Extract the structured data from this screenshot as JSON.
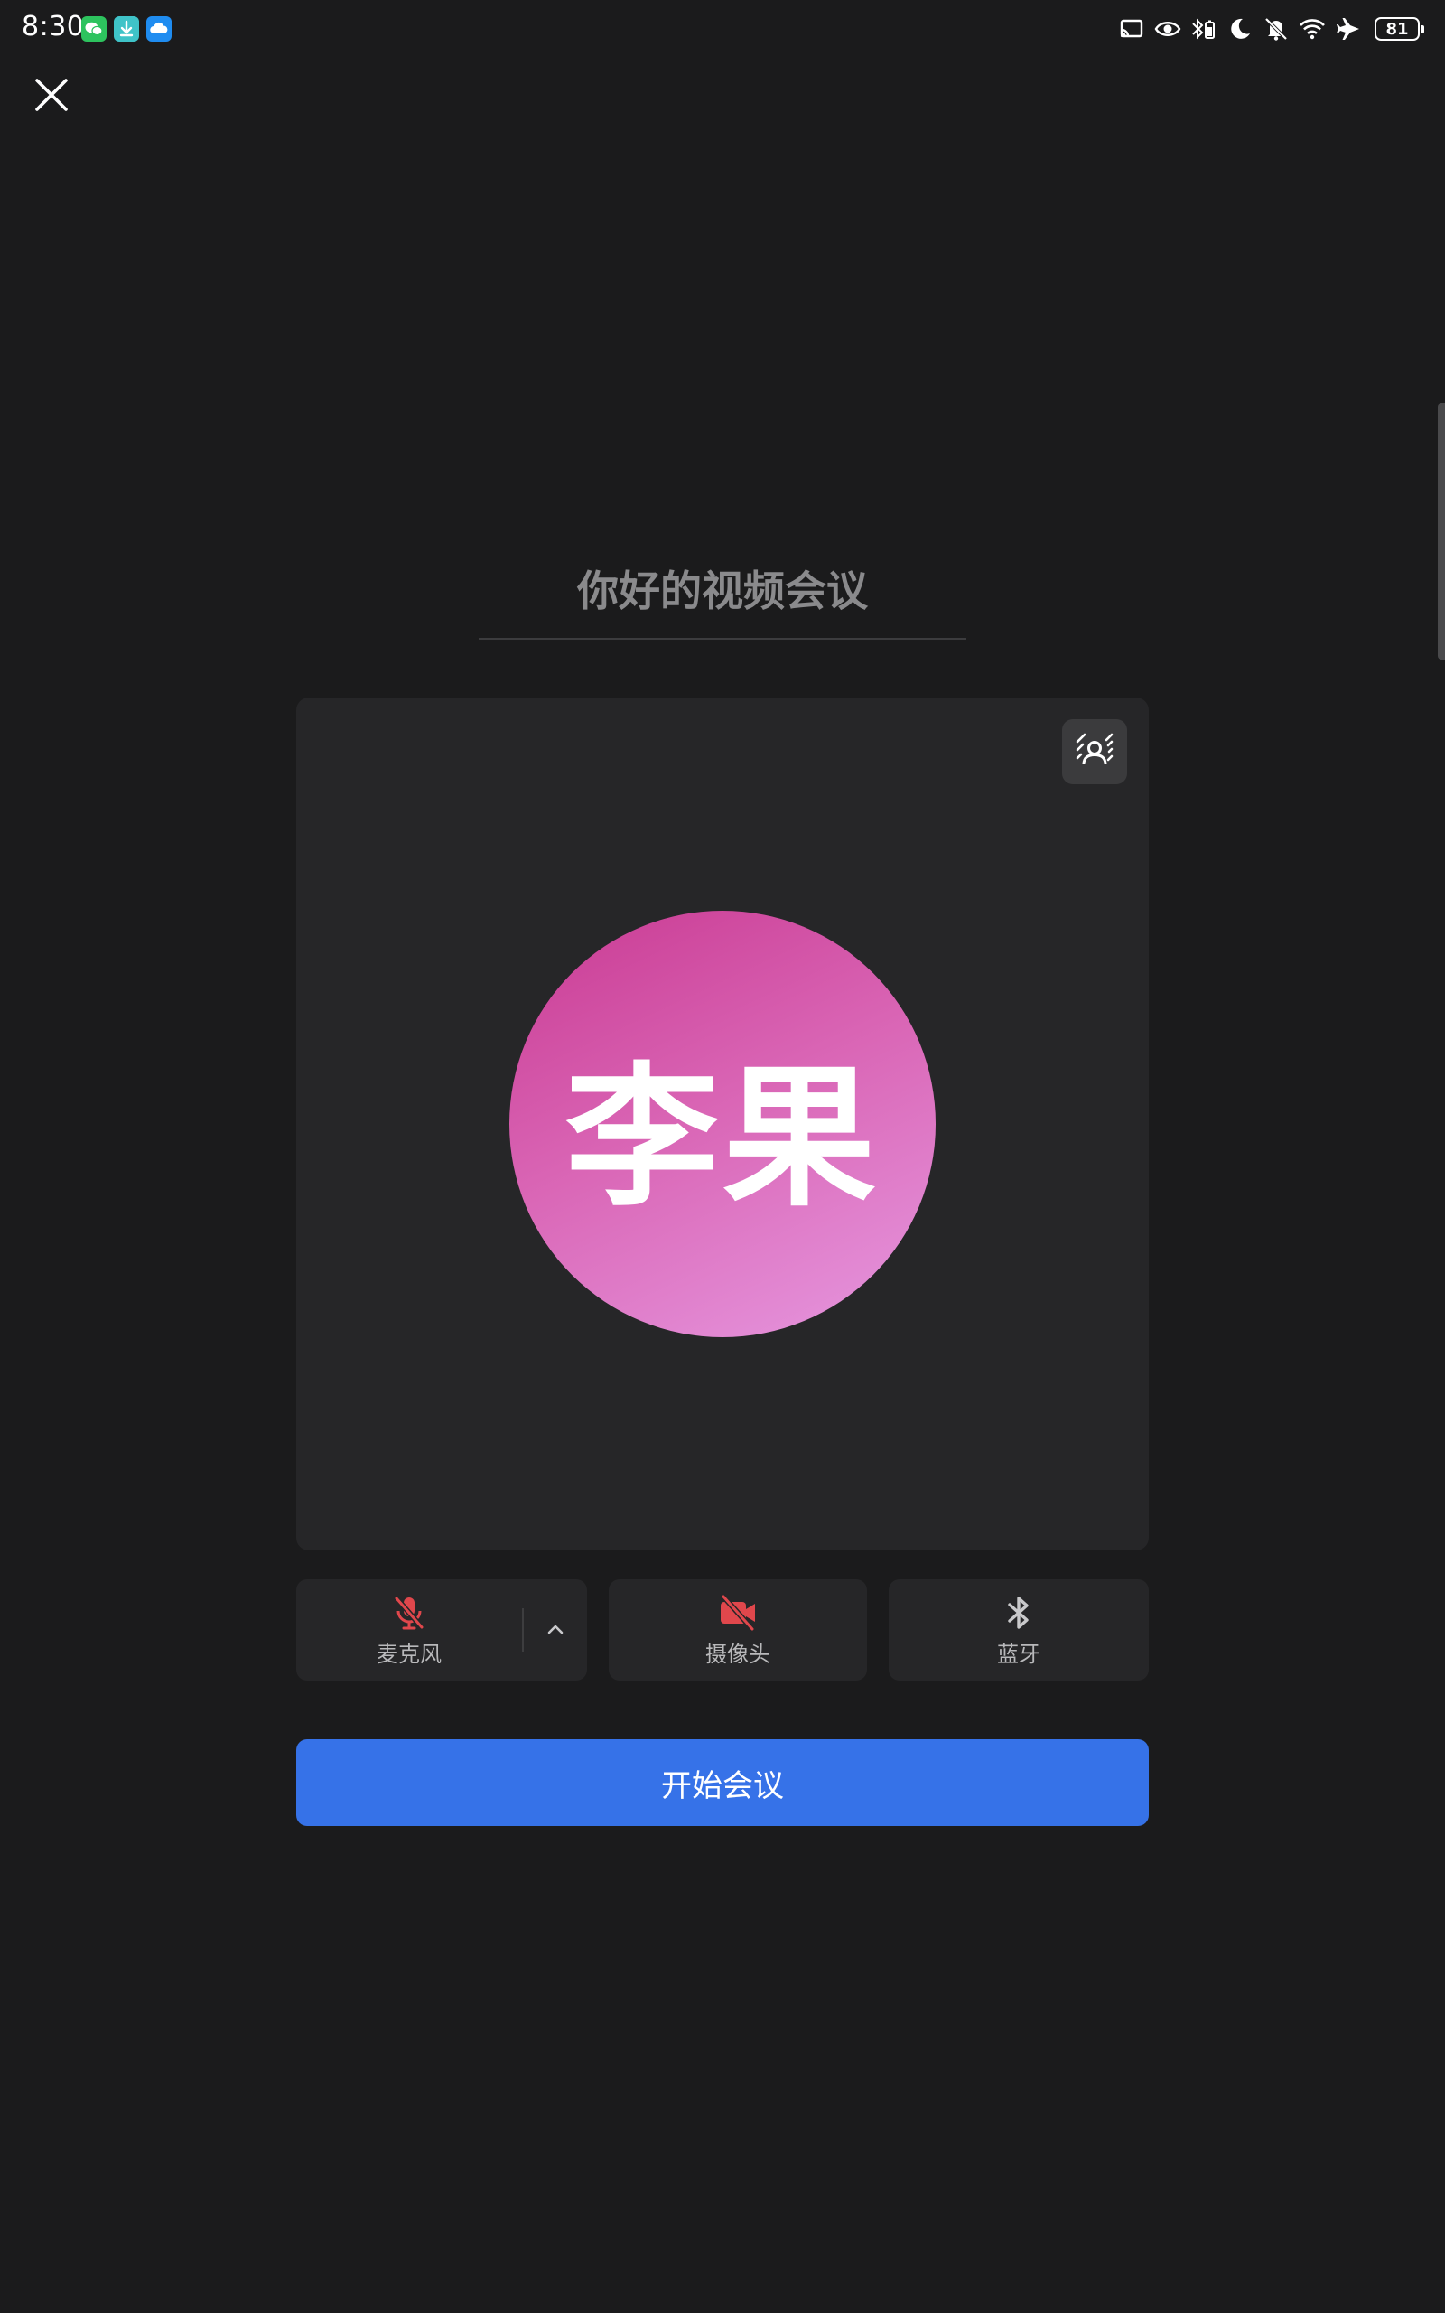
{
  "status_bar": {
    "time": "8:30",
    "notification_apps": [
      "wechat-icon",
      "download-icon",
      "cloud-icon"
    ],
    "system_icons": [
      "cast-icon",
      "eye-icon",
      "bluetooth-battery-icon",
      "moon-icon",
      "bell-off-icon",
      "wifi-icon",
      "airplane-icon"
    ],
    "battery_level": "81"
  },
  "header": {
    "close_icon": "close-icon"
  },
  "meeting": {
    "title": "你好的视频会议"
  },
  "preview": {
    "avatar_name": "李果",
    "background_toggle_icon": "virtual-background-icon",
    "avatar_gradient": [
      "#c93a92",
      "#e698e0"
    ]
  },
  "controls": {
    "mic": {
      "label": "麦克风",
      "icon": "mic-off-icon",
      "state": "off",
      "color": "#e0474c"
    },
    "camera": {
      "label": "摄像头",
      "icon": "camera-off-icon",
      "state": "off",
      "color": "#e0474c"
    },
    "bluetooth": {
      "label": "蓝牙",
      "icon": "bluetooth-icon"
    }
  },
  "actions": {
    "start_label": "开始会议",
    "start_color": "#3672e8"
  },
  "theme": {
    "background": "#1b1b1c",
    "card": "#262628"
  }
}
